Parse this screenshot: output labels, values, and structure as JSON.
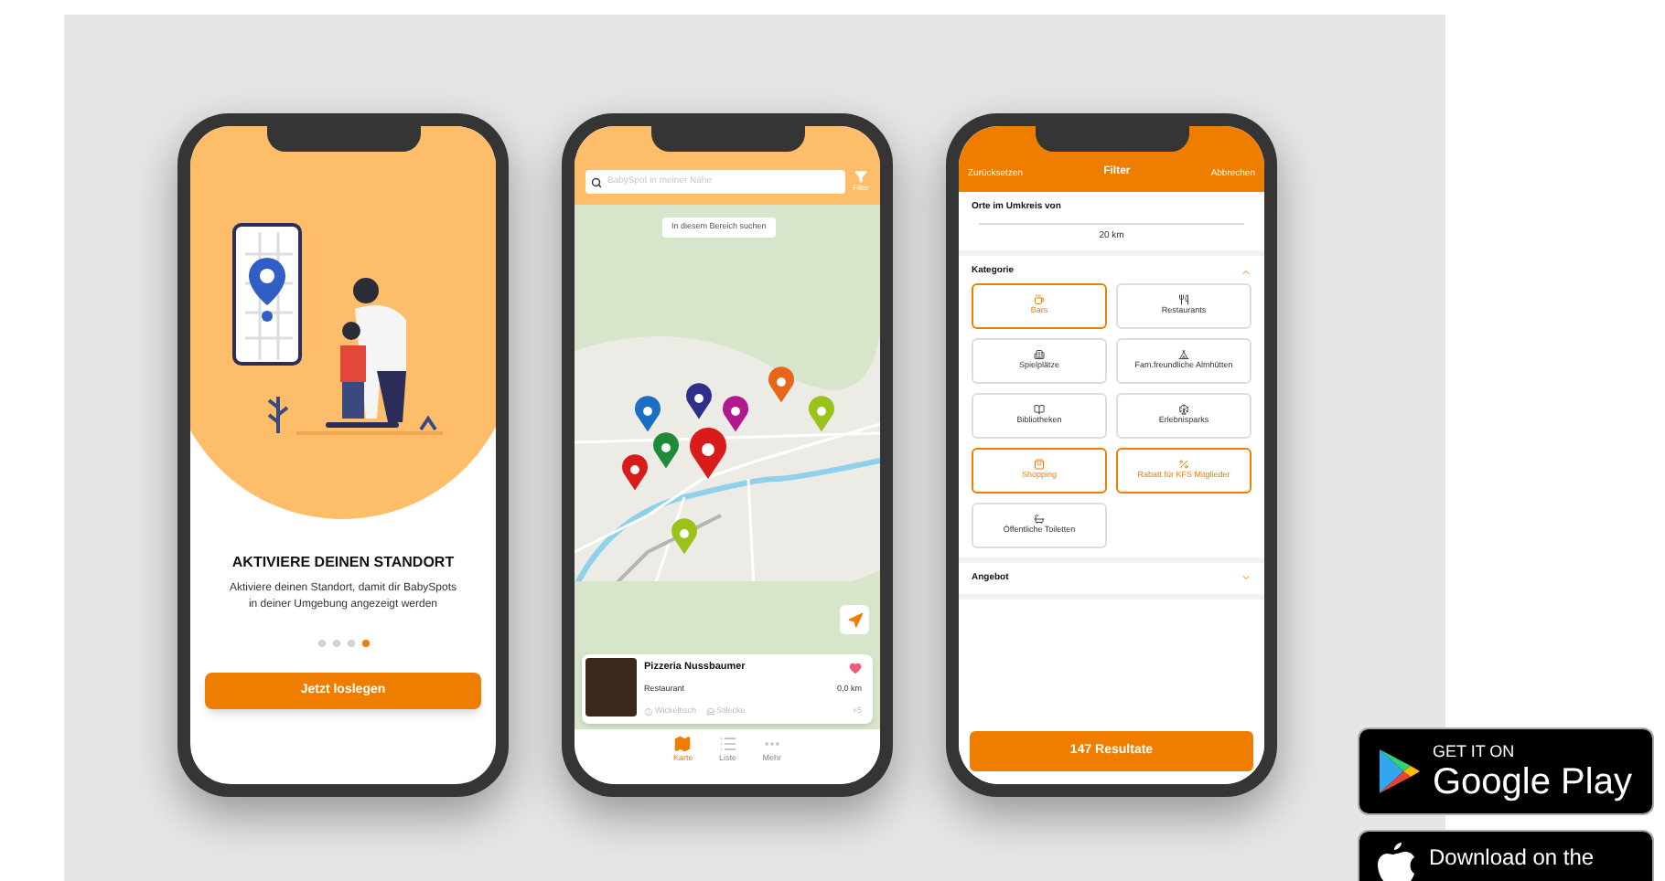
{
  "onboarding": {
    "title": "AKTIVIERE DEINEN STANDORT",
    "text": "Aktiviere deinen Standort, damit dir BabySpots in deiner Umgebung angezeigt werden",
    "pages": [
      {
        "selected": false
      },
      {
        "selected": false
      },
      {
        "selected": false
      },
      {
        "selected": true
      }
    ],
    "button": "Jetzt loslegen"
  },
  "map_screen": {
    "search": {
      "placeholder": "BabySpot in meiner Nähe"
    },
    "filter_label": "Filter",
    "area_button": "In diesem Bereich suchen",
    "place_card": {
      "name": "Pizzeria Nussbaumer",
      "type": "Restaurant",
      "distance": "0,0 km",
      "favorite": true,
      "features": [
        "Wickeltisch",
        "Stilecke"
      ],
      "more": "+5"
    },
    "tabs": [
      {
        "label": "Karte",
        "selected": true
      },
      {
        "label": "Liste",
        "selected": false
      },
      {
        "label": "Mehr",
        "selected": false
      }
    ]
  },
  "filter_screen": {
    "reset": "Zurücksetzen",
    "title": "Filter",
    "cancel": "Abbrechen",
    "radius_label": "Orte im Umkreis von",
    "radius_value": "20 km",
    "sections": [
      {
        "title": "Kategorie",
        "expanded": true,
        "categories": [
          {
            "label": "Bars",
            "selected": true
          },
          {
            "label": "Restaurants",
            "selected": false
          },
          {
            "label": "Spielplätze",
            "selected": false
          },
          {
            "label": "Fam.freundliche Almhütten",
            "selected": false
          },
          {
            "label": "Bibliotheken",
            "selected": false
          },
          {
            "label": "Erlebnisparks",
            "selected": false
          },
          {
            "label": "Shopping",
            "selected": true
          },
          {
            "label": "Rabatt für KFS Mitglieder",
            "selected": true
          },
          {
            "label": "Öffentliche Toiletten",
            "selected": false
          }
        ]
      },
      {
        "title": "Angebot",
        "expanded": false
      }
    ],
    "results_button": "147 Resultate"
  },
  "store_badges": [
    {
      "kind": "google",
      "small": "GET IT ON",
      "large": "Google Play"
    },
    {
      "kind": "apple",
      "small": "Download on the"
    }
  ]
}
